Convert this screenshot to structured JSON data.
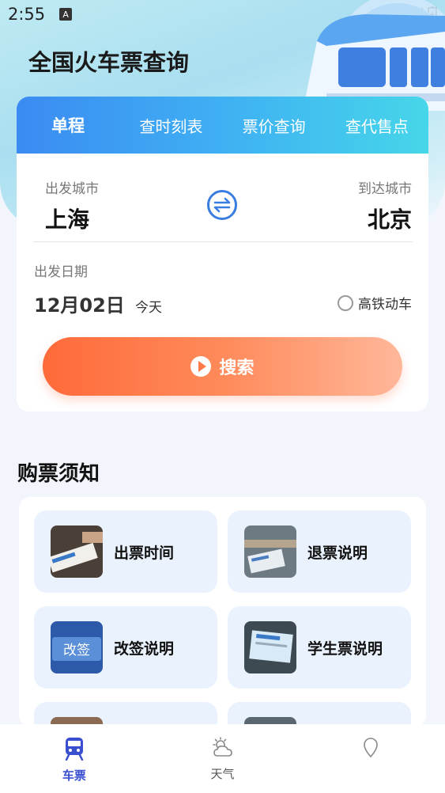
{
  "status_bar": {
    "time": "2:55",
    "notification_letter": "A"
  },
  "app": {
    "title": "全国火车票查询"
  },
  "tabs": [
    {
      "label": "单程",
      "active": true
    },
    {
      "label": "查时刻表",
      "active": false
    },
    {
      "label": "票价查询",
      "active": false
    },
    {
      "label": "查代售点",
      "active": false
    }
  ],
  "search_form": {
    "from_label": "出发城市",
    "from_city": "上海",
    "to_label": "到达城市",
    "to_city": "北京",
    "date_label": "出发日期",
    "date_value": "12月02日",
    "date_sub": "今天",
    "high_speed_label": "高铁动车",
    "high_speed_checked": false,
    "search_label": "搜索"
  },
  "notice": {
    "title": "购票须知",
    "items": [
      {
        "label": "出票时间",
        "icon": "ticket-photo"
      },
      {
        "label": "退票说明",
        "icon": "refund-photo"
      },
      {
        "label": "改签说明",
        "icon": "change-sign-photo"
      },
      {
        "label": "学生票说明",
        "icon": "student-ticket-photo"
      }
    ]
  },
  "bottom_nav": [
    {
      "label": "车票",
      "icon": "train-icon",
      "active": true
    },
    {
      "label": "天气",
      "icon": "weather-icon",
      "active": false
    },
    {
      "label": "",
      "icon": "location-icon",
      "active": false
    }
  ],
  "colors": {
    "tab_gradient_start": "#3b8bf2",
    "tab_gradient_end": "#46d6e9",
    "search_button": "#ff7a48",
    "nav_active": "#3a4fd0"
  }
}
